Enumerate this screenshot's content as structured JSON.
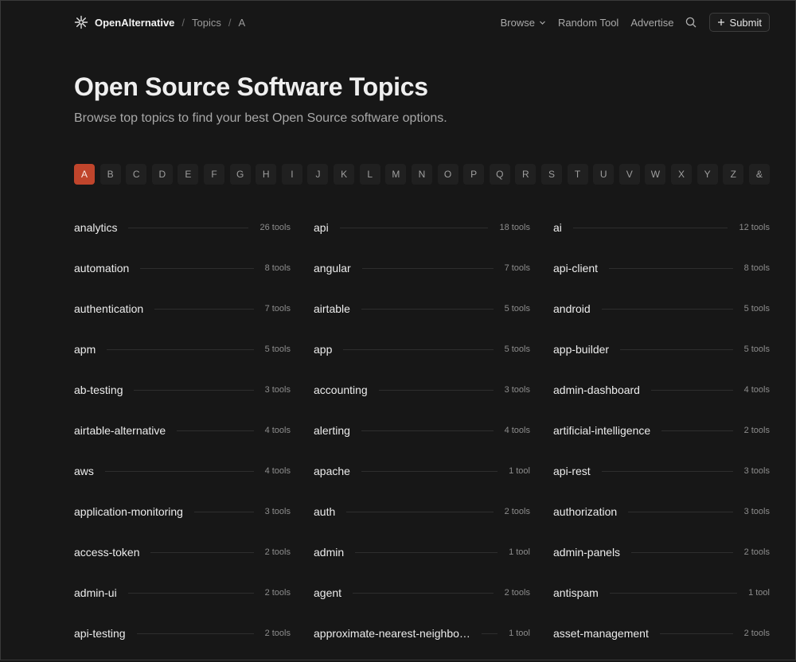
{
  "header": {
    "brand": "OpenAlternative",
    "crumbs": [
      "Topics",
      "A"
    ],
    "nav": {
      "browse": "Browse",
      "random_tool": "Random Tool",
      "advertise": "Advertise",
      "submit": "Submit"
    }
  },
  "hero": {
    "title": "Open Source Software Topics",
    "subtitle": "Browse top topics to find your best Open Source software options."
  },
  "letters": {
    "items": [
      "A",
      "B",
      "C",
      "D",
      "E",
      "F",
      "G",
      "H",
      "I",
      "J",
      "K",
      "L",
      "M",
      "N",
      "O",
      "P",
      "Q",
      "R",
      "S",
      "T",
      "U",
      "V",
      "W",
      "X",
      "Y",
      "Z",
      "&"
    ],
    "active": "A"
  },
  "topics": [
    {
      "name": "analytics",
      "count": "26 tools"
    },
    {
      "name": "api",
      "count": "18 tools"
    },
    {
      "name": "ai",
      "count": "12 tools"
    },
    {
      "name": "automation",
      "count": "8 tools"
    },
    {
      "name": "angular",
      "count": "7 tools"
    },
    {
      "name": "api-client",
      "count": "8 tools"
    },
    {
      "name": "authentication",
      "count": "7 tools"
    },
    {
      "name": "airtable",
      "count": "5 tools"
    },
    {
      "name": "android",
      "count": "5 tools"
    },
    {
      "name": "apm",
      "count": "5 tools"
    },
    {
      "name": "app",
      "count": "5 tools"
    },
    {
      "name": "app-builder",
      "count": "5 tools"
    },
    {
      "name": "ab-testing",
      "count": "3 tools"
    },
    {
      "name": "accounting",
      "count": "3 tools"
    },
    {
      "name": "admin-dashboard",
      "count": "4 tools"
    },
    {
      "name": "airtable-alternative",
      "count": "4 tools"
    },
    {
      "name": "alerting",
      "count": "4 tools"
    },
    {
      "name": "artificial-intelligence",
      "count": "2 tools"
    },
    {
      "name": "aws",
      "count": "4 tools"
    },
    {
      "name": "apache",
      "count": "1 tool"
    },
    {
      "name": "api-rest",
      "count": "3 tools"
    },
    {
      "name": "application-monitoring",
      "count": "3 tools"
    },
    {
      "name": "auth",
      "count": "2 tools"
    },
    {
      "name": "authorization",
      "count": "3 tools"
    },
    {
      "name": "access-token",
      "count": "2 tools"
    },
    {
      "name": "admin",
      "count": "1 tool"
    },
    {
      "name": "admin-panels",
      "count": "2 tools"
    },
    {
      "name": "admin-ui",
      "count": "2 tools"
    },
    {
      "name": "agent",
      "count": "2 tools"
    },
    {
      "name": "antispam",
      "count": "1 tool"
    },
    {
      "name": "api-testing",
      "count": "2 tools"
    },
    {
      "name": "approximate-nearest-neighbor-search",
      "count": "1 tool"
    },
    {
      "name": "asset-management",
      "count": "2 tools"
    }
  ],
  "colors": {
    "background": "#171717",
    "accent": "#c0452c",
    "text": "#ececec",
    "muted": "#8d8d8d"
  }
}
